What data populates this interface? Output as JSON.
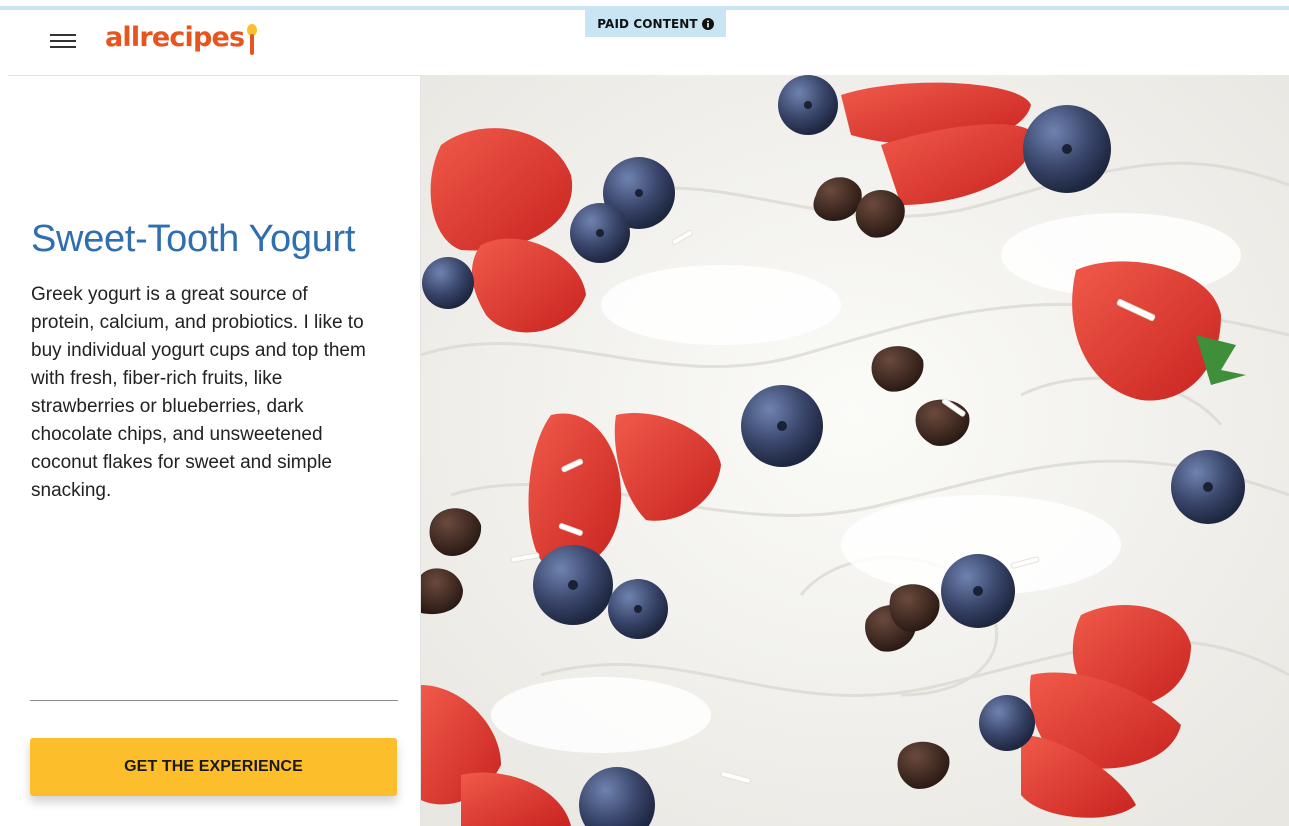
{
  "badge": {
    "label": "PAID CONTENT"
  },
  "brand": {
    "name": "allrecipes",
    "color": "#e8541e"
  },
  "article": {
    "title": "Sweet-Tooth Yogurt",
    "description": "Greek yogurt is a great source of protein, calcium, and probiotics. I like to buy individual yogurt cups and top them with fresh, fiber-rich fruits, like strawberries or blueberries, dark chocolate chips, and unsweetened coconut flakes for sweet and simple snacking."
  },
  "cta": {
    "label": "GET THE EXPERIENCE",
    "color": "#fcbf2b"
  },
  "colors": {
    "title": "#2f6fb0",
    "badge_bg": "#c9e4f2"
  },
  "icons": {
    "menu": "hamburger-menu-icon",
    "info": "info-icon",
    "logo_spoon": "spoon-icon"
  }
}
